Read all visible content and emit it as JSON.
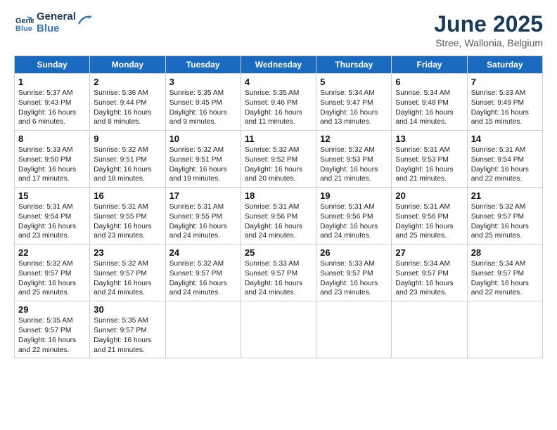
{
  "header": {
    "logo_line1": "General",
    "logo_line2": "Blue",
    "main_title": "June 2025",
    "subtitle": "Stree, Wallonia, Belgium"
  },
  "calendar": {
    "days_of_week": [
      "Sunday",
      "Monday",
      "Tuesday",
      "Wednesday",
      "Thursday",
      "Friday",
      "Saturday"
    ],
    "weeks": [
      [
        {
          "day": "",
          "info": "",
          "empty": true
        },
        {
          "day": "2",
          "info": "Sunrise: 5:36 AM\nSunset: 9:44 PM\nDaylight: 16 hours\nand 8 minutes."
        },
        {
          "day": "3",
          "info": "Sunrise: 5:35 AM\nSunset: 9:45 PM\nDaylight: 16 hours\nand 9 minutes."
        },
        {
          "day": "4",
          "info": "Sunrise: 5:35 AM\nSunset: 9:46 PM\nDaylight: 16 hours\nand 11 minutes."
        },
        {
          "day": "5",
          "info": "Sunrise: 5:34 AM\nSunset: 9:47 PM\nDaylight: 16 hours\nand 13 minutes."
        },
        {
          "day": "6",
          "info": "Sunrise: 5:34 AM\nSunset: 9:48 PM\nDaylight: 16 hours\nand 14 minutes."
        },
        {
          "day": "7",
          "info": "Sunrise: 5:33 AM\nSunset: 9:49 PM\nDaylight: 16 hours\nand 15 minutes."
        }
      ],
      [
        {
          "day": "8",
          "info": "Sunrise: 5:33 AM\nSunset: 9:50 PM\nDaylight: 16 hours\nand 17 minutes."
        },
        {
          "day": "9",
          "info": "Sunrise: 5:32 AM\nSunset: 9:51 PM\nDaylight: 16 hours\nand 18 minutes."
        },
        {
          "day": "10",
          "info": "Sunrise: 5:32 AM\nSunset: 9:51 PM\nDaylight: 16 hours\nand 19 minutes."
        },
        {
          "day": "11",
          "info": "Sunrise: 5:32 AM\nSunset: 9:52 PM\nDaylight: 16 hours\nand 20 minutes."
        },
        {
          "day": "12",
          "info": "Sunrise: 5:32 AM\nSunset: 9:53 PM\nDaylight: 16 hours\nand 21 minutes."
        },
        {
          "day": "13",
          "info": "Sunrise: 5:31 AM\nSunset: 9:53 PM\nDaylight: 16 hours\nand 21 minutes."
        },
        {
          "day": "14",
          "info": "Sunrise: 5:31 AM\nSunset: 9:54 PM\nDaylight: 16 hours\nand 22 minutes."
        }
      ],
      [
        {
          "day": "15",
          "info": "Sunrise: 5:31 AM\nSunset: 9:54 PM\nDaylight: 16 hours\nand 23 minutes."
        },
        {
          "day": "16",
          "info": "Sunrise: 5:31 AM\nSunset: 9:55 PM\nDaylight: 16 hours\nand 23 minutes."
        },
        {
          "day": "17",
          "info": "Sunrise: 5:31 AM\nSunset: 9:55 PM\nDaylight: 16 hours\nand 24 minutes."
        },
        {
          "day": "18",
          "info": "Sunrise: 5:31 AM\nSunset: 9:56 PM\nDaylight: 16 hours\nand 24 minutes."
        },
        {
          "day": "19",
          "info": "Sunrise: 5:31 AM\nSunset: 9:56 PM\nDaylight: 16 hours\nand 24 minutes."
        },
        {
          "day": "20",
          "info": "Sunrise: 5:31 AM\nSunset: 9:56 PM\nDaylight: 16 hours\nand 25 minutes."
        },
        {
          "day": "21",
          "info": "Sunrise: 5:32 AM\nSunset: 9:57 PM\nDaylight: 16 hours\nand 25 minutes."
        }
      ],
      [
        {
          "day": "22",
          "info": "Sunrise: 5:32 AM\nSunset: 9:57 PM\nDaylight: 16 hours\nand 25 minutes."
        },
        {
          "day": "23",
          "info": "Sunrise: 5:32 AM\nSunset: 9:57 PM\nDaylight: 16 hours\nand 24 minutes."
        },
        {
          "day": "24",
          "info": "Sunrise: 5:32 AM\nSunset: 9:57 PM\nDaylight: 16 hours\nand 24 minutes."
        },
        {
          "day": "25",
          "info": "Sunrise: 5:33 AM\nSunset: 9:57 PM\nDaylight: 16 hours\nand 24 minutes."
        },
        {
          "day": "26",
          "info": "Sunrise: 5:33 AM\nSunset: 9:57 PM\nDaylight: 16 hours\nand 23 minutes."
        },
        {
          "day": "27",
          "info": "Sunrise: 5:34 AM\nSunset: 9:57 PM\nDaylight: 16 hours\nand 23 minutes."
        },
        {
          "day": "28",
          "info": "Sunrise: 5:34 AM\nSunset: 9:57 PM\nDaylight: 16 hours\nand 22 minutes."
        }
      ],
      [
        {
          "day": "29",
          "info": "Sunrise: 5:35 AM\nSunset: 9:57 PM\nDaylight: 16 hours\nand 22 minutes."
        },
        {
          "day": "30",
          "info": "Sunrise: 5:35 AM\nSunset: 9:57 PM\nDaylight: 16 hours\nand 21 minutes."
        },
        {
          "day": "",
          "info": "",
          "empty": true
        },
        {
          "day": "",
          "info": "",
          "empty": true
        },
        {
          "day": "",
          "info": "",
          "empty": true
        },
        {
          "day": "",
          "info": "",
          "empty": true
        },
        {
          "day": "",
          "info": "",
          "empty": true
        }
      ]
    ],
    "week1_first": {
      "day": "1",
      "info": "Sunrise: 5:37 AM\nSunset: 9:43 PM\nDaylight: 16 hours\nand 6 minutes."
    }
  }
}
